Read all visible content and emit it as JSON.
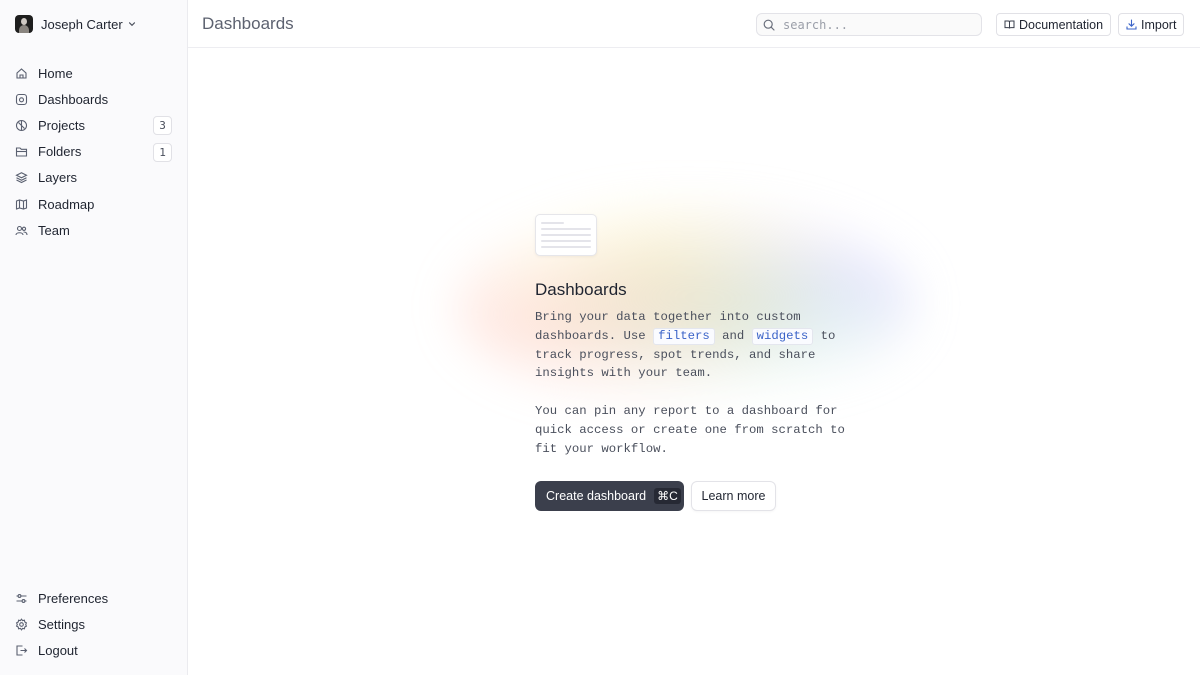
{
  "user": {
    "name": "Joseph Carter"
  },
  "header": {
    "title": "Dashboards",
    "search_placeholder": "search...",
    "documentation_label": "Documentation",
    "import_label": "Import"
  },
  "sidebar": {
    "items": [
      {
        "label": "Home",
        "icon": "home-icon"
      },
      {
        "label": "Dashboards",
        "icon": "dashboard-icon"
      },
      {
        "label": "Projects",
        "icon": "projects-icon",
        "count": "3"
      },
      {
        "label": "Folders",
        "icon": "folder-icon",
        "count": "1"
      },
      {
        "label": "Layers",
        "icon": "layers-icon"
      },
      {
        "label": "Roadmap",
        "icon": "map-icon"
      },
      {
        "label": "Team",
        "icon": "team-icon"
      }
    ],
    "bottom_items": [
      {
        "label": "Preferences",
        "icon": "sliders-icon"
      },
      {
        "label": "Settings",
        "icon": "gear-icon"
      },
      {
        "label": "Logout",
        "icon": "logout-icon"
      }
    ]
  },
  "empty_state": {
    "title": "Dashboards",
    "desc_1a": "Bring your data together into custom dashboards. Use ",
    "kw_filters": "filters",
    "desc_1b": " and ",
    "kw_widgets": "widgets",
    "desc_1c": " to track progress, spot trends, and share insights with your team.",
    "desc_2": "You can pin any report to a dashboard for quick access or create one from scratch to fit your workflow.",
    "primary_button": "Create dashboard",
    "primary_shortcut": "⌘C",
    "secondary_button": "Learn more"
  }
}
